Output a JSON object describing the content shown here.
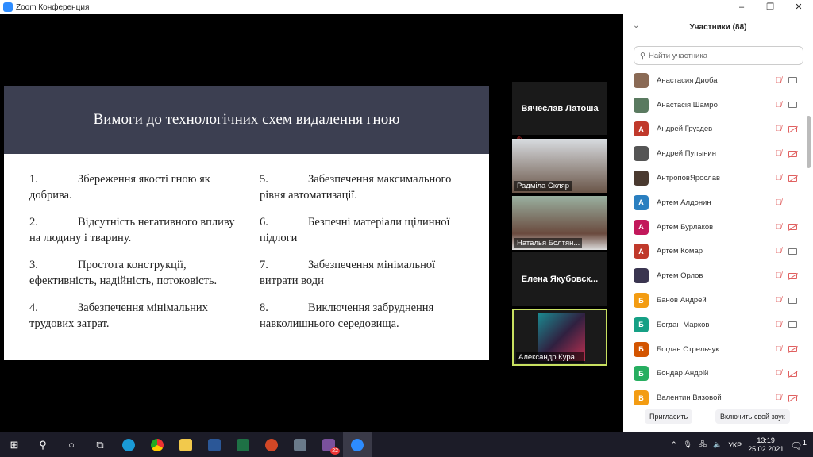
{
  "window": {
    "title": "Zoom Конференция",
    "minimize": "–",
    "maximize": "❐",
    "close": "✕"
  },
  "slide": {
    "title": "Вимоги до технологічних схем видалення гною",
    "left": [
      {
        "n": "1.",
        "t": "Збереження якості гною як добрива."
      },
      {
        "n": "2.",
        "t": "Відсутність негативного впливу на людину і тварину."
      },
      {
        "n": "3.",
        "t": "Простота конструкції, ефективність, надійність, потоковість."
      },
      {
        "n": "4.",
        "t": "Забезпечення мінімальних трудових затрат."
      }
    ],
    "right": [
      {
        "n": "5.",
        "t": "Забезпечення максимального рівня автоматизації."
      },
      {
        "n": "6.",
        "t": "Безпечні матеріали щілинної підлоги"
      },
      {
        "n": "7.",
        "t": "Забезпечення мінімальної витрати води"
      },
      {
        "n": "8.",
        "t": "Виключення забруднення навколишнього середовища."
      }
    ]
  },
  "videos": [
    "Вячеслав Латоша",
    "Радміла Скляр",
    "Наталья Болтян...",
    "Елена  Якубовск...",
    "Александр Кура..."
  ],
  "panel": {
    "title": "Участники (88)",
    "search_placeholder": "Найти участника",
    "invite": "Пригласить",
    "unmute": "Включить свой звук",
    "participants": [
      {
        "name": "Анастасия Диоба",
        "letter": "",
        "color": "#8a6a55",
        "cam": "on"
      },
      {
        "name": "Анастасія Шамро",
        "letter": "",
        "color": "#5a7a60",
        "cam": "on"
      },
      {
        "name": "Андрей Груздев",
        "letter": "А",
        "color": "#c0392b",
        "cam": "off"
      },
      {
        "name": "Андрей Пупынин",
        "letter": "",
        "color": "#555",
        "cam": "off"
      },
      {
        "name": "АнтроповЯрослав",
        "letter": "",
        "color": "#4a3a30",
        "cam": "off"
      },
      {
        "name": "Артем Алдонин",
        "letter": "А",
        "color": "#2a7fc0",
        "cam": "none"
      },
      {
        "name": "Артем Бурлаков",
        "letter": "А",
        "color": "#c2185b",
        "cam": "off"
      },
      {
        "name": "Артем Комар",
        "letter": "А",
        "color": "#c0392b",
        "cam": "on"
      },
      {
        "name": "Артем Орлов",
        "letter": "",
        "color": "#3a3550",
        "cam": "off"
      },
      {
        "name": "Банов Андрей",
        "letter": "Б",
        "color": "#f39c12",
        "cam": "on"
      },
      {
        "name": "Богдан Марков",
        "letter": "Б",
        "color": "#16a085",
        "cam": "on"
      },
      {
        "name": "Богдан Стрельчук",
        "letter": "Б",
        "color": "#d35400",
        "cam": "off"
      },
      {
        "name": "Бондар Андрій",
        "letter": "Б",
        "color": "#27ae60",
        "cam": "off"
      },
      {
        "name": "Валентин Вязовой",
        "letter": "В",
        "color": "#f39c12",
        "cam": "off"
      }
    ]
  },
  "taskbar": {
    "lang": "УКР",
    "time": "13:19",
    "date": "25.02.2021",
    "badge": "22",
    "notif": "1"
  }
}
